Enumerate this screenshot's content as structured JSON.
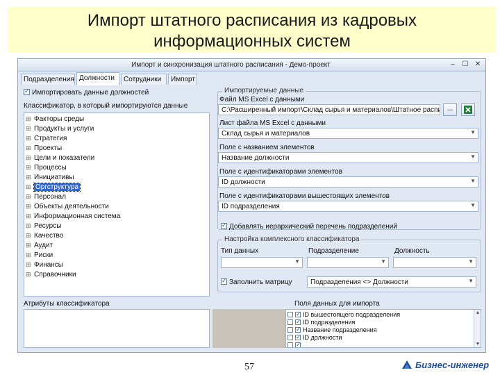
{
  "slide": {
    "title_line1": "Импорт штатного расписания из кадровых",
    "title_line2": "информационных систем",
    "page_number": "57",
    "brand": "Бизнес-инженер"
  },
  "window": {
    "title": "Импорт и синхронизация штатного расписания - Демо-проект",
    "controls": [
      "–",
      "☐",
      "✕"
    ]
  },
  "tabs": [
    "Подразделения",
    "Должности",
    "Сотрудники",
    "Импорт"
  ],
  "left": {
    "import_checkbox": "Импортировать данные должностей",
    "classifier_label": "Классификатор, в который импортируются данные",
    "tree": [
      {
        "label": "Факторы среды",
        "exp": "⊞"
      },
      {
        "label": "Продукты и услуги",
        "exp": "⊞"
      },
      {
        "label": "Стратегия",
        "exp": "⊞"
      },
      {
        "label": "Проекты",
        "exp": "⊞"
      },
      {
        "label": "Цели и показатели",
        "exp": "⊞"
      },
      {
        "label": "Процессы",
        "exp": "⊞"
      },
      {
        "label": "Инициативы",
        "exp": "⊞"
      },
      {
        "label": "Оргструктура",
        "exp": "⊞",
        "selected": true
      },
      {
        "label": "Персонал",
        "exp": "⊞"
      },
      {
        "label": "Объекты деятельности",
        "exp": "⊞"
      },
      {
        "label": "Информационная система",
        "exp": "⊞"
      },
      {
        "label": "Ресурсы",
        "exp": "⊞"
      },
      {
        "label": "Качество",
        "exp": "⊞"
      },
      {
        "label": "Аудит",
        "exp": "⊞"
      },
      {
        "label": "Риски",
        "exp": "⊞"
      },
      {
        "label": "Финансы",
        "exp": "⊞"
      },
      {
        "label": "Справочники",
        "exp": "⊞"
      }
    ],
    "attributes_label": "Атрибуты классификатора"
  },
  "right": {
    "group_legend": "Импортируемые данные",
    "excel_file_label": "Файл MS Excel с данными",
    "excel_file_value": "C:\\Расширенный импорт\\Склад сырья и материалов\\Штатное распи",
    "browse_label": "...",
    "sheet_label": "Лист файла MS Excel с данными",
    "sheet_value": "Склад сырья и материалов",
    "name_field_label": "Поле с названием элементов",
    "name_field_value": "Название должности",
    "id_field_label": "Поле с идентификаторами элементов",
    "id_field_value": "ID должности",
    "parent_id_label": "Поле с идентификаторами вышестоящих элементов",
    "parent_id_value": "ID подразделения",
    "add_hierarchy": "Добавлять иерархический перечень подразделений",
    "complex_legend": "Настройка комплексного классификатора",
    "col_type": "Тип данных",
    "col_dept": "Подразделение",
    "col_pos": "Должность",
    "type_value": "",
    "dept_value": "",
    "pos_value": "",
    "fill_matrix": "Заполнить матрицу",
    "matrix_value": "Подразделения <> Должности",
    "fields_label": "Поля данных для импорта",
    "fields": [
      "ID вышестоящего подразделения",
      "ID подразделения",
      "Название подразделения",
      "ID должности",
      ""
    ]
  },
  "colors": {
    "title_band": "#ffffcc",
    "window_bg": "#dfe8f3",
    "selection": "#3366cc",
    "brand": "#1f4fa0"
  },
  "icons": {
    "excel": "excel-icon",
    "logo": "business-engineer-logo-icon"
  }
}
